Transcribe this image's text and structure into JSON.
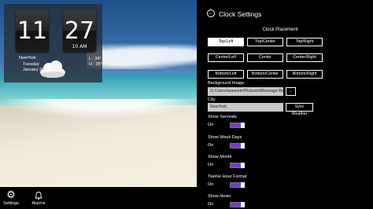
{
  "clock_widget": {
    "hour": "11",
    "minute": "27",
    "ampm": "10 AM",
    "city": "NewYork",
    "day": "Tuesday",
    "date": "January 29",
    "low": "L : 34°",
    "high": "H : 35°",
    "weather_icon": "cloud-icon"
  },
  "app_bar": {
    "settings_label": "Settings",
    "settings_icon": "gear-icon",
    "alarms_label": "Alarms",
    "alarms_icon": "bell-icon"
  },
  "settings": {
    "title": "Clock Settings",
    "back_icon": "back-arrow-icon",
    "placement_title": "Clock Placement",
    "placements": [
      {
        "label": "Top/Left",
        "selected": true
      },
      {
        "label": "Top/Center",
        "selected": false
      },
      {
        "label": "Top/Right",
        "selected": false
      },
      {
        "label": "Center/Left",
        "selected": false
      },
      {
        "label": "Center",
        "selected": false
      },
      {
        "label": "Center/Right",
        "selected": false
      },
      {
        "label": "Bottom/Left",
        "selected": false
      },
      {
        "label": "Bottom/Center",
        "selected": false
      },
      {
        "label": "Bottom/Right",
        "selected": false
      }
    ],
    "background_label": "Background Image",
    "background_value": "G:\\Users\\waseem\\Pictures\\Message Boa",
    "browse_label": "...",
    "city_label": "City",
    "city_value": "NewYork",
    "sync_label": "Sync Weather",
    "toggles": [
      {
        "label": "Show Seconds",
        "state": "On"
      },
      {
        "label": "Show Week Days",
        "state": "On"
      },
      {
        "label": "Show Month",
        "state": "On"
      },
      {
        "label": "Twelve Hour Format",
        "state": "On"
      },
      {
        "label": "Show News",
        "state": "On"
      }
    ],
    "accent_color": "#6f3fc9"
  }
}
